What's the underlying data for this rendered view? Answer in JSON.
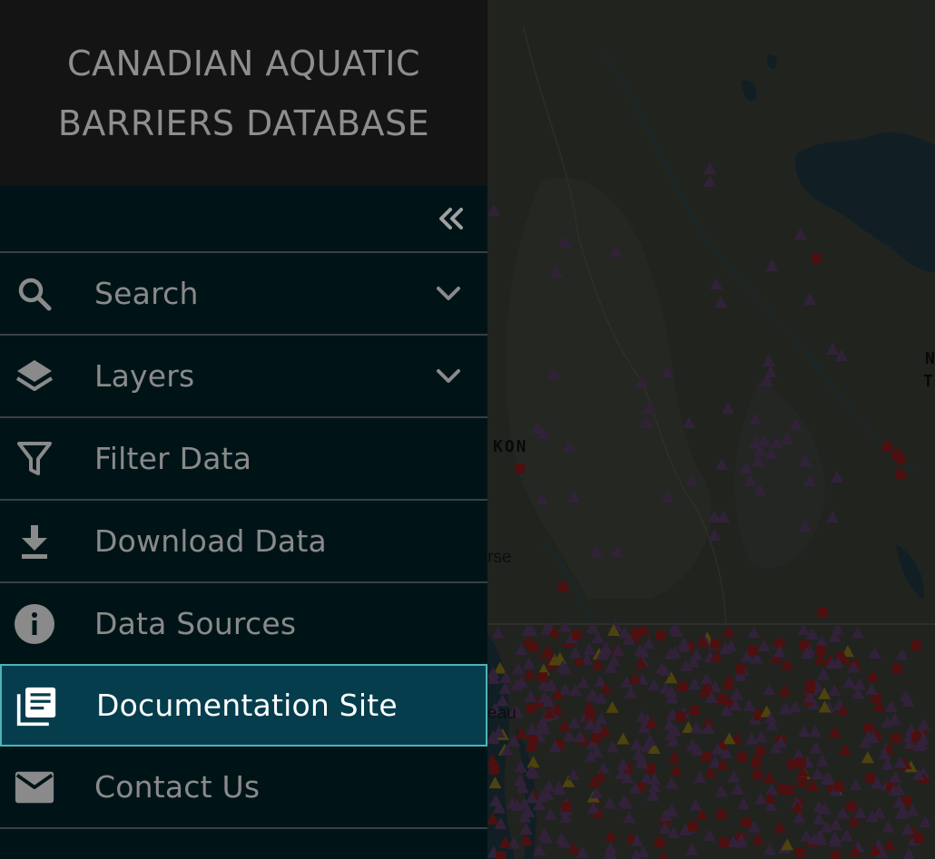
{
  "app": {
    "title_line1": "CANADIAN AQUATIC",
    "title_line2": "BARRIERS DATABASE"
  },
  "sidebar": {
    "collapse_icon": "double-chevron-left-icon",
    "items": [
      {
        "label": "Search",
        "icon": "search-icon",
        "expandable": true
      },
      {
        "label": "Layers",
        "icon": "layers-icon",
        "expandable": true
      },
      {
        "label": "Filter Data",
        "icon": "filter-icon",
        "expandable": false
      },
      {
        "label": "Download Data",
        "icon": "download-icon",
        "expandable": false
      },
      {
        "label": "Data Sources",
        "icon": "info-icon",
        "expandable": false
      },
      {
        "label": "Documentation Site",
        "icon": "library-books-icon",
        "expandable": false,
        "active": true
      },
      {
        "label": "Contact Us",
        "icon": "mail-icon",
        "expandable": false
      }
    ]
  },
  "map": {
    "labels": {
      "region_yukon": "KON",
      "region_nwt_1": "N",
      "region_nwt_2": "T",
      "city_whitehorse": "rse",
      "city_bc": "eau"
    }
  },
  "colors": {
    "sidebar_bg": "#001418",
    "header_bg": "#141414",
    "active_bg": "#053d4d",
    "active_border": "#4db3b8",
    "text_muted": "#8a8a8a",
    "marker_purple": "#5a3f6b",
    "marker_red": "#8b1e1e",
    "marker_yellow": "#8a7a1a"
  }
}
